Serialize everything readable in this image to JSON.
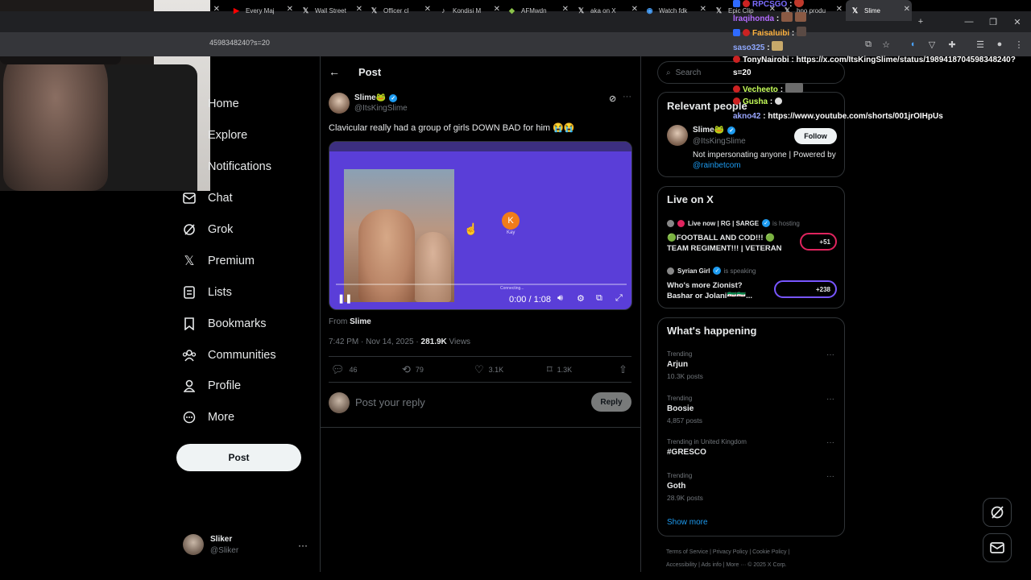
{
  "browser": {
    "tabs": [
      {
        "label": "Every Maj",
        "icon": "youtube-icon",
        "color": "#ff0000"
      },
      {
        "label": "Wall Street",
        "icon": "x-icon",
        "color": "#ffffff"
      },
      {
        "label": "Officer cl",
        "icon": "x-icon",
        "color": "#ffffff"
      },
      {
        "label": "Kondisi M",
        "icon": "tiktok-icon",
        "color": "#ffffff"
      },
      {
        "label": "AFMwdn",
        "icon": "leaf-icon",
        "color": "#8bc34a"
      },
      {
        "label": "aka on X",
        "icon": "x-icon",
        "color": "#ffffff"
      },
      {
        "label": "Watch fdk",
        "icon": "globe-icon",
        "color": "#4aa3ff"
      },
      {
        "label": "Epic Clip",
        "icon": "x-icon",
        "color": "#ffffff"
      },
      {
        "label": "bno produ",
        "icon": "x-icon",
        "color": "#ffffff"
      },
      {
        "label": "Slime",
        "icon": "x-icon",
        "color": "#ffffff"
      }
    ],
    "new_tab": "+",
    "url": "4598348240?s=20"
  },
  "nav": {
    "home": "Home",
    "explore": "Explore",
    "notifications": "Notifications",
    "chat": "Chat",
    "grok": "Grok",
    "premium": "Premium",
    "lists": "Lists",
    "bookmarks": "Bookmarks",
    "communities": "Communities",
    "profile": "Profile",
    "more": "More",
    "post_button": "Post"
  },
  "account": {
    "name": "Sliker",
    "handle": "@Sliker"
  },
  "main": {
    "header": "Post",
    "author": {
      "name": "Slime🐸",
      "handle": "@ItsKingSlime"
    },
    "text": "Clavicular really had a group of girls DOWN BAD for him 😭😭",
    "video": {
      "time": "0:00 / 1:08",
      "caller_initial": "K",
      "caller_name": "Kay",
      "status": "Connecting..."
    },
    "from_prefix": "From",
    "from_name": "Slime",
    "timestamp": "7:42 PM · Nov 14, 2025 · ",
    "views_count": "281.9K",
    "views_label": " Views",
    "actions": {
      "replies": "46",
      "reposts": "79",
      "likes": "3.1K",
      "bookmarks": "1.3K"
    },
    "reply_placeholder": "Post your reply",
    "reply_button": "Reply"
  },
  "right": {
    "search_placeholder": "Search",
    "relevant": {
      "title": "Relevant people",
      "name": "Slime🐸",
      "handle": "@ItsKingSlime",
      "bio": "Not impersonating anyone | Powered by ",
      "bio_link": "@rainbetcom",
      "follow": "Follow"
    },
    "live": {
      "title": "Live on X",
      "items": [
        {
          "host": "Live now | RG | SARGE",
          "status": "is hosting",
          "title": "🟢FOOTBALL AND COD!!! 🟢 TEAM REGIMENT!!! | VETERAN",
          "count": "+51"
        },
        {
          "host": "Syrian Girl",
          "status": "is speaking",
          "title": "Who's more Zionist? Bashar or Jolani🇸🇾🇸🇾...",
          "count": "+238"
        }
      ]
    },
    "happening": {
      "title": "What's happening",
      "trends": [
        {
          "context": "Trending",
          "name": "Arjun",
          "count": "10.3K posts"
        },
        {
          "context": "Trending",
          "name": "Boosie",
          "count": "4,857 posts"
        },
        {
          "context": "Trending in United Kingdom",
          "name": "#GRESCO",
          "count": ""
        },
        {
          "context": "Trending",
          "name": "Goth",
          "count": "28.9K posts"
        }
      ],
      "show_more": "Show more"
    },
    "footer": {
      "line1": "Terms of Service  |  Privacy Policy  |  Cookie Policy  |",
      "line2": "Accessibility  |  Ads info  |  More ···  © 2025 X Corp."
    }
  },
  "chat_overlay": [
    {
      "user": "RPCSGO",
      "text": " : ",
      "color": "#7b6cff"
    },
    {
      "user": "lraqihonda",
      "text": " : ",
      "color": "#b36bff"
    },
    {
      "user": "Faisaluibi",
      "text": " : ",
      "color": "#ffb23e"
    },
    {
      "user": "saso325",
      "text": " : ",
      "color": "#8fa8ff"
    },
    {
      "user": "TonyNairobi",
      "text": " : https://x.com/ItsKingSlime/status/1989418704598348240?",
      "color": "#ffffff"
    },
    {
      "user": "",
      "text": "s=20",
      "color": "#ffffff"
    },
    {
      "user": "Vecheeto",
      "text": " : ",
      "color": "#c6ff5a"
    },
    {
      "user": "Gusha",
      "text": " : ",
      "color": "#c6ff5a"
    },
    {
      "user": "akno42",
      "text": " : https://www.youtube.com/shorts/001jrOIHpUs",
      "color": "#9aa6ff"
    }
  ]
}
